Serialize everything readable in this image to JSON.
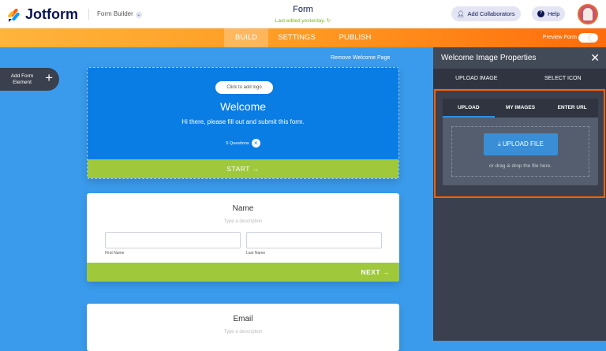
{
  "header": {
    "brand": "Jotform",
    "form_builder": "Form Builder",
    "title": "Form",
    "last_edited": "Last edited yesterday.",
    "add_collaborators": "Add Collaborators",
    "help": "Help"
  },
  "nav": {
    "tabs": [
      "BUILD",
      "SETTINGS",
      "PUBLISH"
    ],
    "active": "BUILD",
    "preview_form": "Preview Form"
  },
  "canvas": {
    "add_form_element": "Add Form Element",
    "remove_welcome": "Remove Welcome Page",
    "welcome": {
      "logo": "Click to add logo",
      "heading": "Welcome",
      "text": "Hi there, please fill out and submit this form.",
      "questions": "5 Questions",
      "start": "START"
    },
    "name_card": {
      "title": "Name",
      "description": "Type a description",
      "first": "First Name",
      "last": "Last Name",
      "next": "NEXT"
    },
    "email_card": {
      "title": "Email",
      "description": "Type a description"
    }
  },
  "panel": {
    "title": "Welcome Image Properties",
    "tabs": [
      "UPLOAD IMAGE",
      "SELECT ICON"
    ],
    "inner_tabs": [
      "UPLOAD",
      "MY IMAGES",
      "ENTER URL"
    ],
    "upload_file": "UPLOAD FILE",
    "drag_drop": "or drag & drop the file here."
  },
  "colors": {
    "orange": "#ff6100",
    "green": "#9fc93b",
    "blue": "#0a7de4"
  }
}
